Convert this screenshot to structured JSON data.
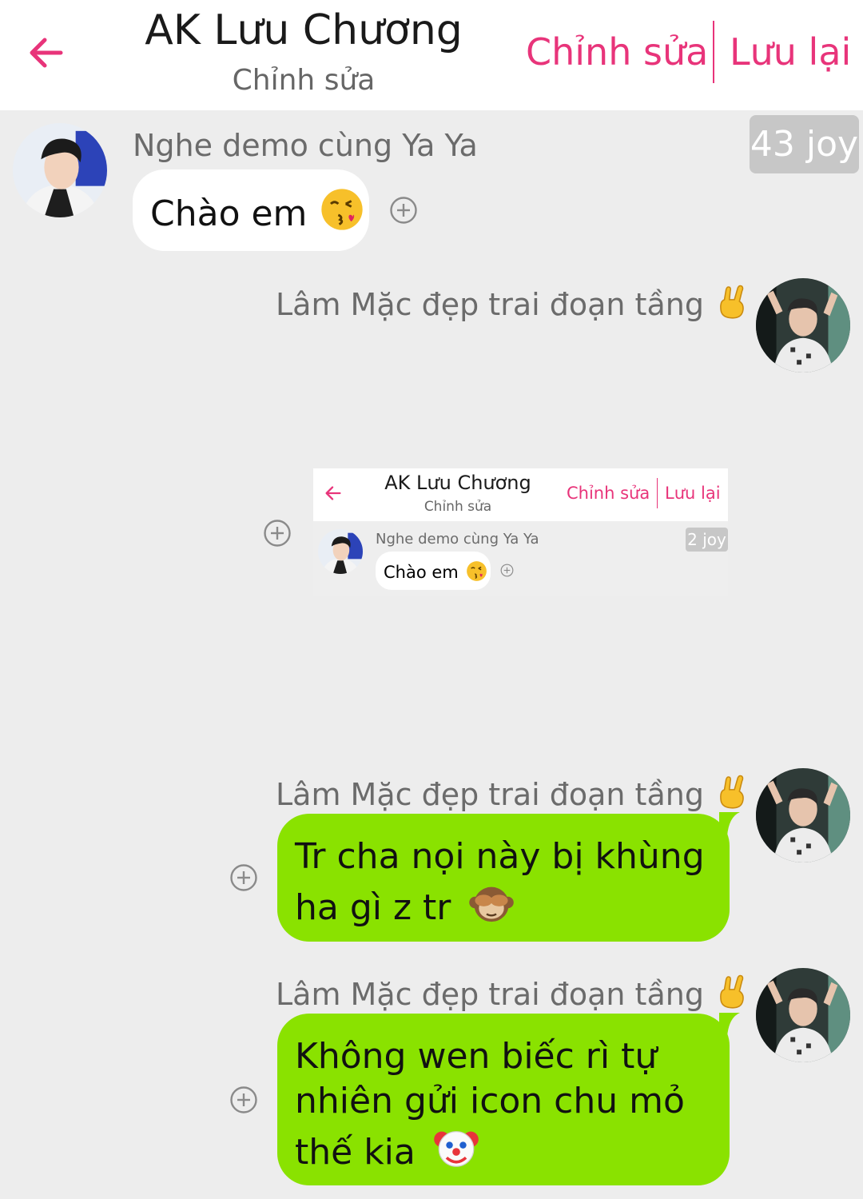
{
  "header": {
    "title": "AK Lưu Chương",
    "subtitle": "Chỉnh sửa",
    "edit_label": "Chỉnh sửa",
    "save_label": "Lưu lại",
    "accent": "#e8347a"
  },
  "joy_badge": "43 joy",
  "messages": [
    {
      "sender": "Nghe demo cùng Ya Ya",
      "text": "Chào em",
      "emoji": "kissing-face-with-heart"
    },
    {
      "sender": "Lâm Mặc đẹp trai đoạn tầng",
      "sender_emoji": "sign-of-the-horns",
      "content": "screenshot"
    },
    {
      "sender": "Lâm Mặc đẹp trai đoạn tầng",
      "sender_emoji": "sign-of-the-horns",
      "lines": [
        "Tr cha nọi này bị khùng",
        "ha gì z tr"
      ],
      "emoji": "see-no-evil-monkey"
    },
    {
      "sender": "Lâm Mặc đẹp trai đoạn tầng",
      "sender_emoji": "sign-of-the-horns",
      "lines": [
        "Không wen biếc rì tự",
        "nhiên gửi icon chu mỏ",
        "thế kia"
      ],
      "emoji": "clown-face"
    }
  ],
  "screenshot": {
    "title": "AK Lưu Chương",
    "subtitle": "Chỉnh sửa",
    "edit_label": "Chỉnh sửa",
    "save_label": "Lưu lại",
    "sender": "Nghe demo cùng Ya Ya",
    "joy_badge": "2 joy",
    "text": "Chào em"
  },
  "colors": {
    "background": "#ededed",
    "outgoing_bubble": "#8ae200",
    "incoming_bubble": "#ffffff"
  }
}
